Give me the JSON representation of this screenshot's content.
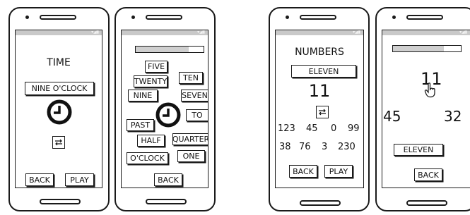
{
  "time_screen": {
    "title": "TIME",
    "time_button": "NINE O'CLOCK",
    "clock_icon": "clock-icon",
    "swap_icon": "swap-arrows-icon",
    "back": "BACK",
    "play": "PLAY"
  },
  "time_words_screen": {
    "progress": 0.78,
    "words": [
      "FIVE",
      "TWENTY",
      "TEN",
      "NINE",
      "SEVEN",
      "TO",
      "PAST",
      "HALF",
      "QUARTER",
      "O'CLOCK",
      "ONE"
    ],
    "clock_icon": "clock-icon",
    "back": "BACK"
  },
  "numbers_screen": {
    "title": "NUMBERS",
    "number_button": "ELEVEN",
    "number": "11",
    "swap_icon": "swap-arrows-icon",
    "number_rows": [
      [
        "123",
        "45",
        "0",
        "99"
      ],
      [
        "38",
        "76",
        "3",
        "230"
      ]
    ],
    "back": "BACK",
    "play": "PLAY"
  },
  "numbers_game_screen": {
    "progress": 0.75,
    "number": "11",
    "cursor_icon": "hand-pointer-icon",
    "left_number": "45",
    "right_number": "32",
    "number_button": "ELEVEN",
    "back": "BACK"
  }
}
